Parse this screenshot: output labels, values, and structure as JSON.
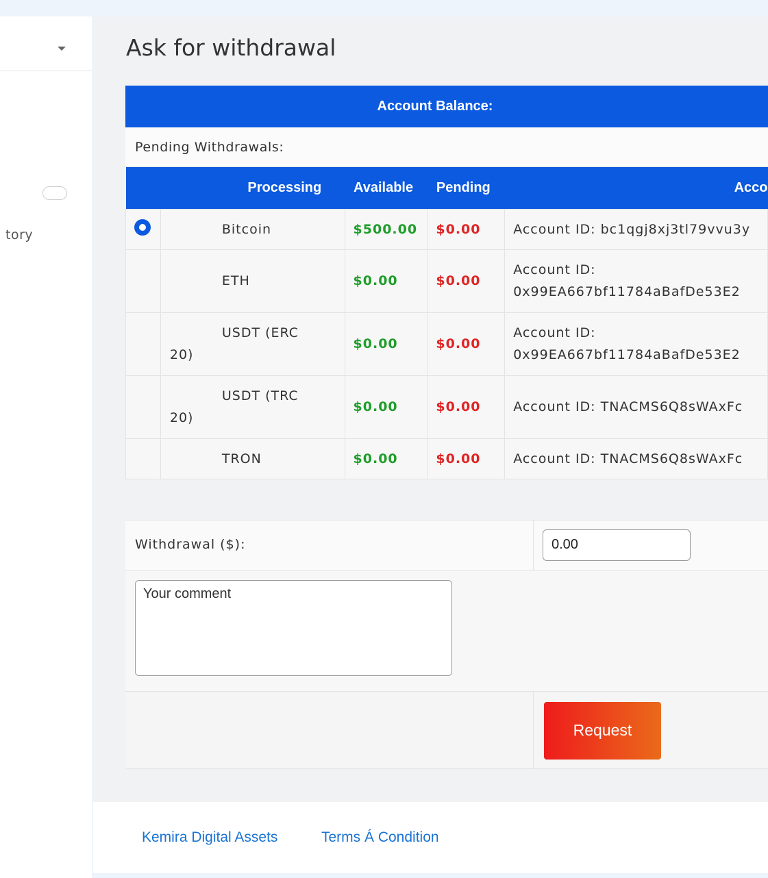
{
  "sidebar": {
    "history_partial": "tory"
  },
  "page": {
    "title": "Ask for withdrawal"
  },
  "balance": {
    "header": "Account Balance:",
    "pending_label": "Pending Withdrawals:"
  },
  "table": {
    "headers": {
      "processing": "Processing",
      "available": "Available",
      "pending": "Pending",
      "account": "Acco"
    },
    "rows": [
      {
        "name": "Bitcoin",
        "wrap": "",
        "available": "$500.00",
        "pending": "$0.00",
        "account_label": "Account ID: bc1qgj8xj3tl79vvu3y",
        "account_line2": "",
        "selected": true
      },
      {
        "name": "ETH",
        "wrap": "",
        "available": "$0.00",
        "pending": "$0.00",
        "account_label": "Account ID:",
        "account_line2": "0x99EA667bf11784aBafDe53E2",
        "selected": false
      },
      {
        "name": "USDT (ERC",
        "wrap": "20)",
        "available": "$0.00",
        "pending": "$0.00",
        "account_label": "Account ID:",
        "account_line2": "0x99EA667bf11784aBafDe53E2",
        "selected": false
      },
      {
        "name": "USDT (TRC",
        "wrap": "20)",
        "available": "$0.00",
        "pending": "$0.00",
        "account_label": "Account ID: TNACMS6Q8sWAxFc",
        "account_line2": "",
        "selected": false
      },
      {
        "name": "TRON",
        "wrap": "",
        "available": "$0.00",
        "pending": "$0.00",
        "account_label": "Account ID: TNACMS6Q8sWAxFc",
        "account_line2": "",
        "selected": false
      }
    ]
  },
  "form": {
    "withdrawal_label": "Withdrawal ($):",
    "withdrawal_value": "0.00",
    "comment_placeholder": "Your comment",
    "request_label": "Request"
  },
  "footer": {
    "link1": "Kemira Digital Assets",
    "link2": "Terms Á Condition"
  },
  "colors": {
    "accent": "#0b5ae0",
    "available": "#1f9d2a",
    "pending": "#e02424",
    "button_start": "#ee1c1c",
    "button_end": "#ea6a1a"
  }
}
